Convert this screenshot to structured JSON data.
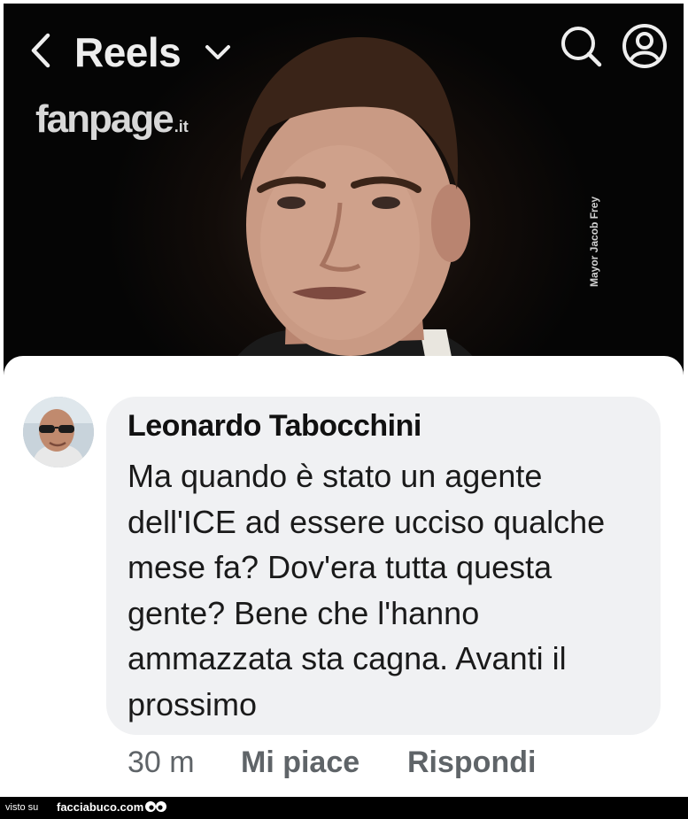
{
  "header": {
    "title": "Reels",
    "back_icon": "chevron-left-icon",
    "dropdown_icon": "chevron-down-icon",
    "search_icon": "search-icon",
    "profile_icon": "profile-icon"
  },
  "video": {
    "brand": "fanpage",
    "brand_tld": ".it",
    "credit": "Mayor Jacob Frey"
  },
  "comment": {
    "author": "Leonardo Tabocchini",
    "text": "Ma quando è stato un agente dell'ICE ad essere ucciso qualche mese fa? Dov'era tutta questa gente? Bene che l'hanno ammazzata sta cagna. Avanti il prossimo",
    "time": "30 m",
    "like_label": "Mi piace",
    "reply_label": "Rispondi"
  },
  "watermark": {
    "prefix": "visto su",
    "site": "facciabuco.com"
  },
  "colors": {
    "bubble": "#f0f1f3",
    "meta_text": "#5f6468",
    "video_bg": "#050505"
  }
}
